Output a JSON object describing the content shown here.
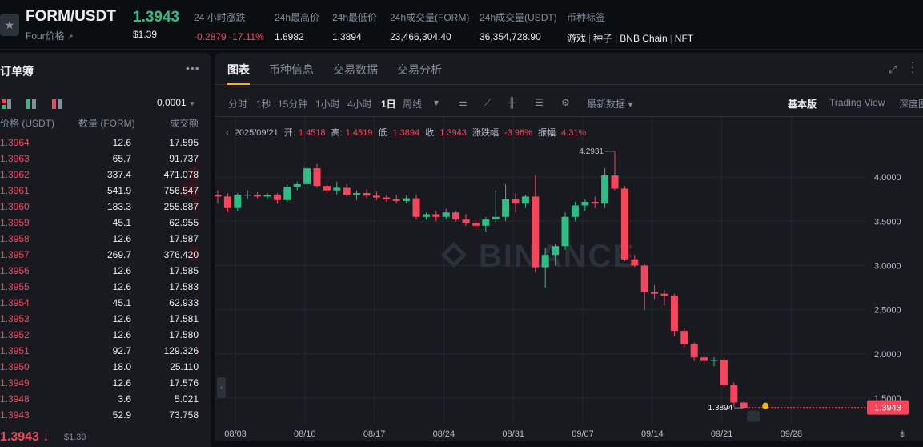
{
  "header": {
    "pair": "FORM/USDT",
    "sub_label": "Four价格",
    "price": "1.3943",
    "price_usd": "$1.39",
    "stats": [
      {
        "label": "24 小时涨跌",
        "value": "-0.2879 -17.11%"
      },
      {
        "label": "24h最高价",
        "value": "1.6982"
      },
      {
        "label": "24h最低价",
        "value": "1.3894"
      },
      {
        "label": "24h成交量(FORM)",
        "value": "23,466,304.40"
      },
      {
        "label": "24h成交量(USDT)",
        "value": "36,354,728.90"
      }
    ],
    "tags_label": "币种标签",
    "tags": [
      "游戏",
      "种子",
      "BNB Chain",
      "NFT"
    ],
    "colors": {
      "up": "#2ebd85",
      "down": "#f6465d",
      "accent": "#f0b90b"
    }
  },
  "orderbook": {
    "title": "订单簿",
    "precision": "0.0001",
    "headers": {
      "price": "价格 (USDT)",
      "qty": "数量 (FORM)",
      "total": "成交额"
    },
    "rows": [
      {
        "price": "1.3964",
        "qty": "12.6",
        "total": "17.595"
      },
      {
        "price": "1.3963",
        "qty": "65.7",
        "total": "91.737"
      },
      {
        "price": "1.3962",
        "qty": "337.4",
        "total": "471.078"
      },
      {
        "price": "1.3961",
        "qty": "541.9",
        "total": "756.547"
      },
      {
        "price": "1.3960",
        "qty": "183.3",
        "total": "255.887"
      },
      {
        "price": "1.3959",
        "qty": "45.1",
        "total": "62.955"
      },
      {
        "price": "1.3958",
        "qty": "12.6",
        "total": "17.587"
      },
      {
        "price": "1.3957",
        "qty": "269.7",
        "total": "376.420"
      },
      {
        "price": "1.3956",
        "qty": "12.6",
        "total": "17.585"
      },
      {
        "price": "1.3955",
        "qty": "12.6",
        "total": "17.583"
      },
      {
        "price": "1.3954",
        "qty": "45.1",
        "total": "62.933"
      },
      {
        "price": "1.3953",
        "qty": "12.6",
        "total": "17.581"
      },
      {
        "price": "1.3952",
        "qty": "12.6",
        "total": "17.580"
      },
      {
        "price": "1.3951",
        "qty": "92.7",
        "total": "129.326"
      },
      {
        "price": "1.3950",
        "qty": "18.0",
        "total": "25.110"
      },
      {
        "price": "1.3949",
        "qty": "12.6",
        "total": "17.576"
      },
      {
        "price": "1.3948",
        "qty": "3.6",
        "total": "5.021"
      },
      {
        "price": "1.3943",
        "qty": "52.9",
        "total": "73.758"
      }
    ],
    "last_price": "1.3943",
    "last_arrow": "↓",
    "last_usd": "$1.39"
  },
  "chart_panel": {
    "tabs": [
      "图表",
      "币种信息",
      "交易数据",
      "交易分析"
    ],
    "active_tab": 0,
    "intervals": [
      "分时",
      "1秒",
      "15分钟",
      "1小时",
      "4小时",
      "1日",
      "周线"
    ],
    "active_interval": "1日",
    "latest_data": "最新数据",
    "views": [
      "基本版",
      "Trading View",
      "深度图"
    ],
    "active_view": "基本版",
    "ohlc": {
      "date": "2025/09/21",
      "open_label": "开:",
      "open": "1.4518",
      "high_label": "高:",
      "high": "1.4519",
      "low_label": "低:",
      "low": "1.3894",
      "close_label": "收:",
      "close": "1.3943",
      "change_label": "涨跌幅:",
      "change": "-3.96%",
      "amp_label": "振幅:",
      "amp": "4.31%"
    },
    "watermark": "BINANCE"
  },
  "chart_data": {
    "type": "candlestick",
    "yticks": [
      "4.0000",
      "3.5000",
      "3.0000",
      "2.5000",
      "2.0000",
      "1.5000"
    ],
    "ylim": [
      1.2,
      4.5
    ],
    "xticks": [
      "08/03",
      "08/10",
      "08/17",
      "08/24",
      "08/31",
      "09/07",
      "09/14",
      "09/21",
      "09/28"
    ],
    "max_label": "4.2931",
    "min_label": "1.3894",
    "current_price": "1.3943",
    "candles": [
      [
        3.8,
        3.85,
        3.7,
        3.78
      ],
      [
        3.78,
        3.82,
        3.6,
        3.65
      ],
      [
        3.65,
        3.82,
        3.62,
        3.8
      ],
      [
        3.8,
        3.85,
        3.75,
        3.8
      ],
      [
        3.8,
        3.83,
        3.76,
        3.78
      ],
      [
        3.78,
        3.82,
        3.75,
        3.8
      ],
      [
        3.8,
        3.82,
        3.7,
        3.74
      ],
      [
        3.74,
        3.92,
        3.72,
        3.89
      ],
      [
        3.89,
        3.95,
        3.85,
        3.92
      ],
      [
        3.92,
        4.14,
        3.88,
        4.1
      ],
      [
        4.1,
        4.15,
        3.88,
        3.9
      ],
      [
        3.9,
        3.92,
        3.82,
        3.85
      ],
      [
        3.85,
        3.95,
        3.8,
        3.88
      ],
      [
        3.88,
        3.92,
        3.78,
        3.8
      ],
      [
        3.8,
        3.85,
        3.74,
        3.82
      ],
      [
        3.82,
        3.86,
        3.76,
        3.79
      ],
      [
        3.79,
        3.84,
        3.74,
        3.77
      ],
      [
        3.77,
        3.8,
        3.72,
        3.75
      ],
      [
        3.75,
        3.8,
        3.7,
        3.73
      ],
      [
        3.73,
        3.79,
        3.7,
        3.76
      ],
      [
        3.76,
        3.8,
        3.52,
        3.55
      ],
      [
        3.55,
        3.6,
        3.52,
        3.58
      ],
      [
        3.58,
        3.62,
        3.5,
        3.55
      ],
      [
        3.55,
        3.64,
        3.52,
        3.6
      ],
      [
        3.6,
        3.62,
        3.5,
        3.52
      ],
      [
        3.52,
        3.58,
        3.45,
        3.48
      ],
      [
        3.48,
        3.52,
        3.4,
        3.45
      ],
      [
        3.45,
        3.55,
        3.38,
        3.52
      ],
      [
        3.52,
        3.85,
        3.48,
        3.55
      ],
      [
        3.55,
        3.92,
        3.5,
        3.75
      ],
      [
        3.75,
        3.82,
        3.6,
        3.7
      ],
      [
        3.7,
        3.8,
        3.65,
        3.78
      ],
      [
        3.78,
        4.02,
        2.92,
        2.98
      ],
      [
        2.98,
        3.2,
        2.75,
        3.12
      ],
      [
        3.12,
        3.25,
        3.0,
        3.22
      ],
      [
        3.22,
        3.6,
        3.18,
        3.55
      ],
      [
        3.55,
        3.72,
        3.5,
        3.68
      ],
      [
        3.68,
        3.75,
        3.62,
        3.72
      ],
      [
        3.72,
        3.78,
        3.65,
        3.7
      ],
      [
        3.7,
        4.1,
        3.65,
        4.02
      ],
      [
        4.02,
        4.29,
        3.85,
        3.87
      ],
      [
        3.87,
        3.9,
        3.05,
        3.07
      ],
      [
        3.07,
        3.12,
        2.98,
        3.0
      ],
      [
        3.0,
        3.02,
        2.5,
        2.7
      ],
      [
        2.7,
        2.78,
        2.62,
        2.68
      ],
      [
        2.68,
        2.72,
        2.55,
        2.66
      ],
      [
        2.66,
        2.68,
        2.2,
        2.26
      ],
      [
        2.26,
        2.3,
        2.08,
        2.11
      ],
      [
        2.11,
        2.13,
        1.92,
        1.96
      ],
      [
        1.96,
        2.0,
        1.88,
        1.92
      ],
      [
        1.92,
        1.96,
        1.86,
        1.93
      ],
      [
        1.93,
        1.95,
        1.62,
        1.65
      ],
      [
        1.65,
        1.68,
        1.4,
        1.45
      ],
      [
        1.45,
        1.46,
        1.39,
        1.39
      ]
    ]
  }
}
